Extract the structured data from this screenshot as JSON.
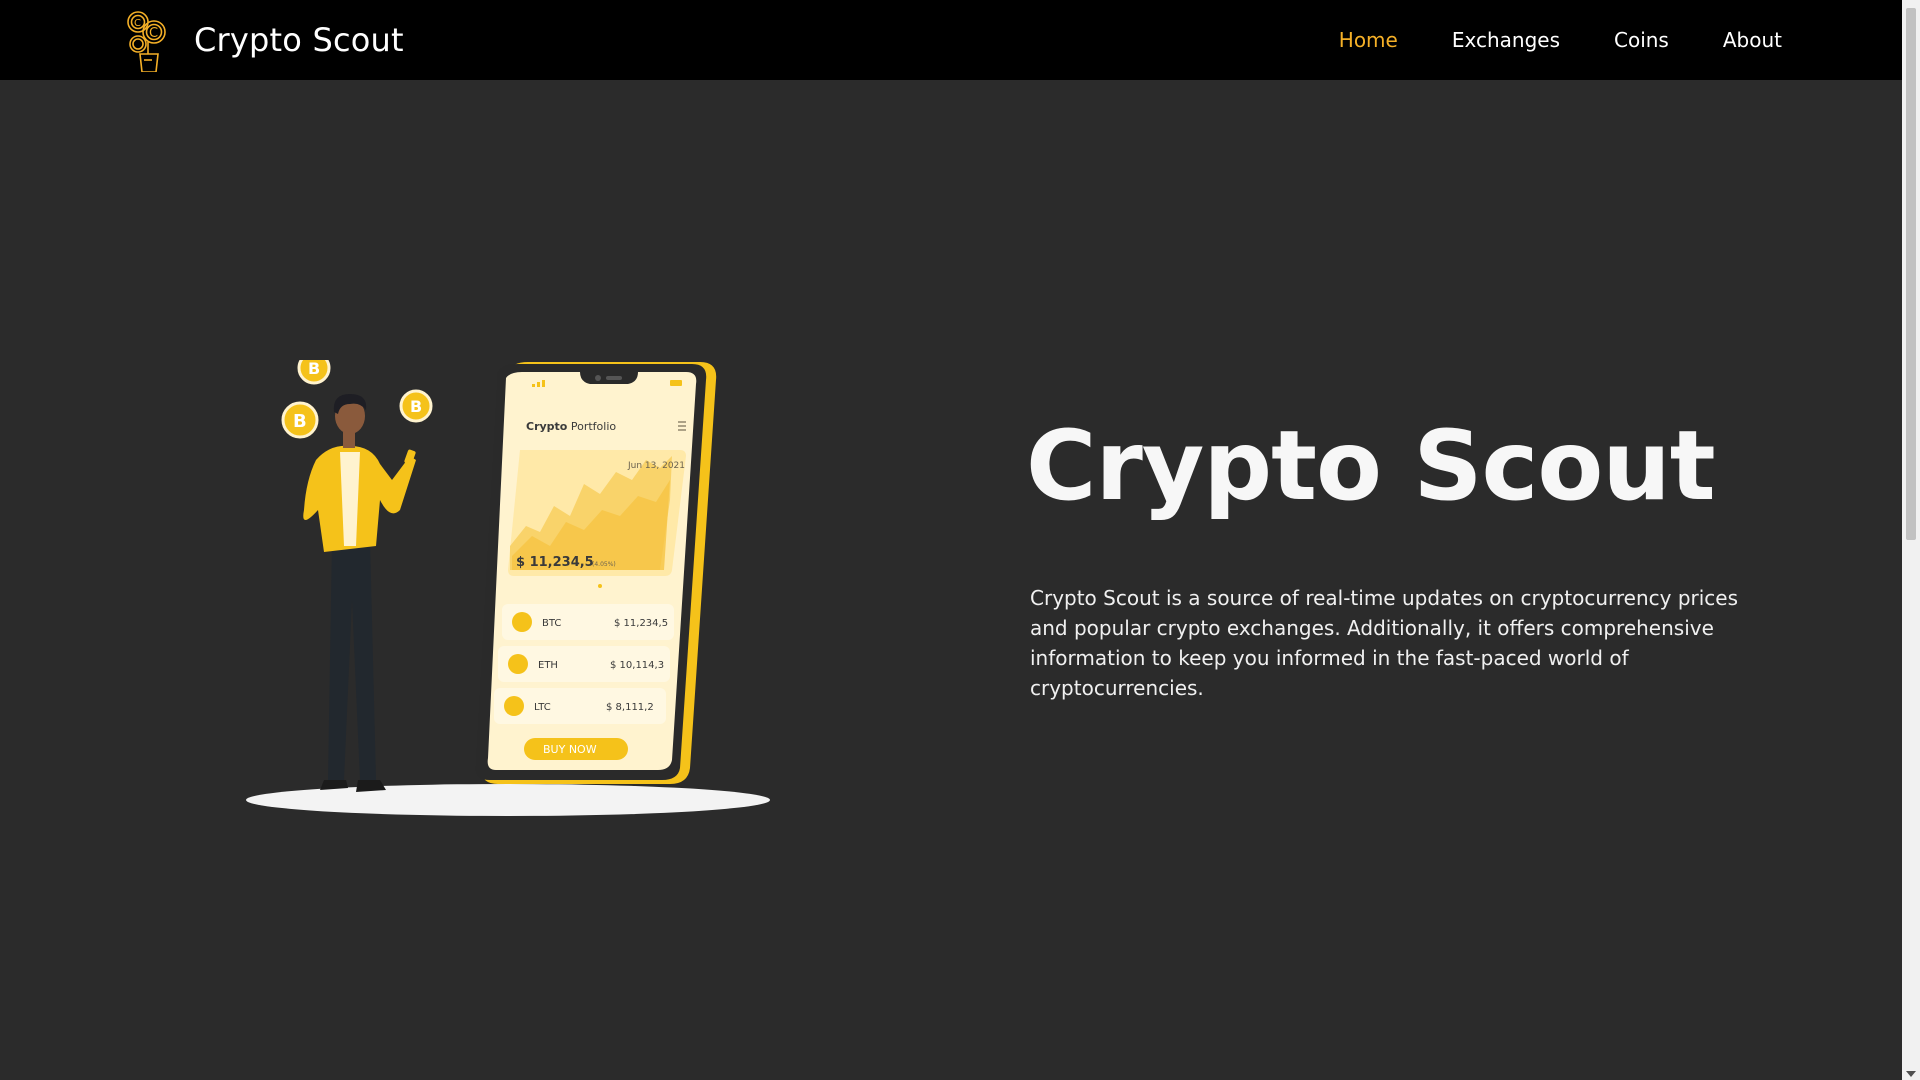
{
  "navbar": {
    "brand_title": "Crypto Scout",
    "links": [
      {
        "label": "Home",
        "active": true
      },
      {
        "label": "Exchanges",
        "active": false
      },
      {
        "label": "Coins",
        "active": false
      },
      {
        "label": "About",
        "active": false
      }
    ]
  },
  "hero": {
    "title": "Crypto Scout",
    "description": "Crypto Scout is a source of real-time updates on cryptocurrency prices and popular crypto exchanges. Additionally, it offers comprehensive information to keep you informed in the fast-paced world of cryptocurrencies."
  },
  "illustration": {
    "phone_title_bold": "Crypto",
    "phone_title_rest": " Portfolio",
    "date": "Jun 13, 2021",
    "balance": "$ 11,234,5",
    "balance_change": "(4.05%)",
    "coins": [
      {
        "symbol": "BTC",
        "price": "$ 11,234,5"
      },
      {
        "symbol": "ETH",
        "price": "$ 10,114,3"
      },
      {
        "symbol": "LTC",
        "price": "$ 8,111,2"
      }
    ],
    "buy_button": "BUY NOW",
    "coin_letter": "B"
  },
  "colors": {
    "accent": "#f5b027",
    "navbar_bg": "#000000",
    "page_bg": "#2b2b2b",
    "text": "#ffffff"
  }
}
